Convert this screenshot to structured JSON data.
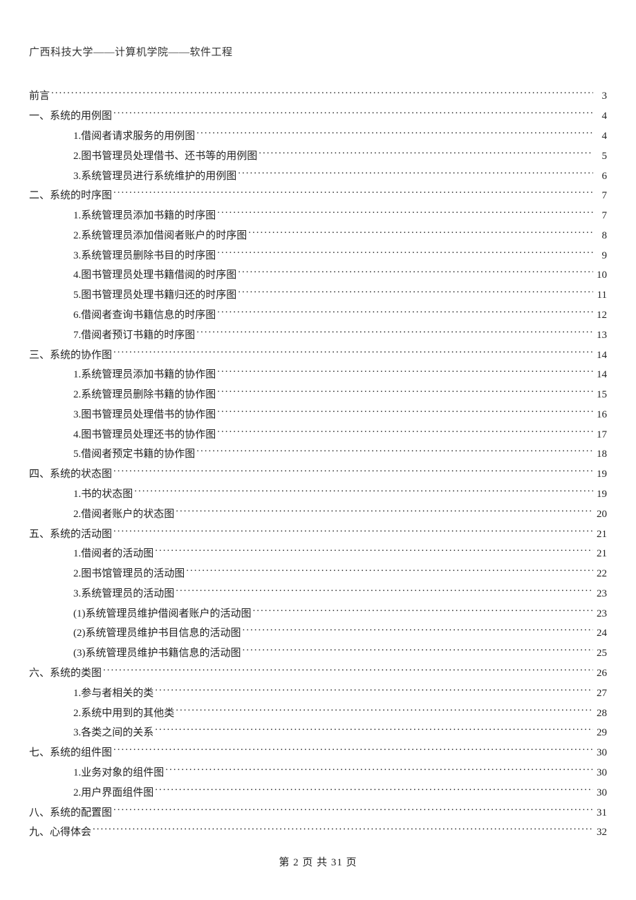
{
  "header": "广西科技大学——计算机学院——软件工程",
  "footer": "第 2 页 共 31 页",
  "toc": [
    {
      "level": 0,
      "title": "前言",
      "page": 3
    },
    {
      "level": 0,
      "title": "一、系统的用例图",
      "page": 4
    },
    {
      "level": 1,
      "title": "1.借阅者请求服务的用例图",
      "page": 4
    },
    {
      "level": 1,
      "title": "2.图书管理员处理借书、还书等的用例图",
      "page": 5
    },
    {
      "level": 1,
      "title": "3.系统管理员进行系统维护的用例图",
      "page": 6
    },
    {
      "level": 0,
      "title": "二、系统的时序图",
      "page": 7
    },
    {
      "level": 1,
      "title": "1.系统管理员添加书籍的时序图",
      "page": 7
    },
    {
      "level": 1,
      "title": "2.系统管理员添加借阅者账户的时序图",
      "page": 8
    },
    {
      "level": 1,
      "title": "3.系统管理员删除书目的时序图",
      "page": 9
    },
    {
      "level": 1,
      "title": "4.图书管理员处理书籍借阅的时序图",
      "page": 10
    },
    {
      "level": 1,
      "title": "5.图书管理员处理书籍归还的时序图",
      "page": 11
    },
    {
      "level": 1,
      "title": "6.借阅者查询书籍信息的时序图",
      "page": 12
    },
    {
      "level": 1,
      "title": "7.借阅者预订书籍的时序图",
      "page": 13
    },
    {
      "level": 0,
      "title": "三、系统的协作图",
      "page": 14
    },
    {
      "level": 1,
      "title": "1.系统管理员添加书籍的协作图",
      "page": 14
    },
    {
      "level": 1,
      "title": "2.系统管理员删除书籍的协作图",
      "page": 15
    },
    {
      "level": 1,
      "title": "3.图书管理员处理借书的协作图",
      "page": 16
    },
    {
      "level": 1,
      "title": "4.图书管理员处理还书的协作图",
      "page": 17
    },
    {
      "level": 1,
      "title": "5.借阅者预定书籍的协作图",
      "page": 18
    },
    {
      "level": 0,
      "title": "四、系统的状态图",
      "page": 19
    },
    {
      "level": 1,
      "title": "1.书的状态图",
      "page": 19
    },
    {
      "level": 1,
      "title": "2.借阅者账户的状态图",
      "page": 20
    },
    {
      "level": 0,
      "title": "五、系统的活动图",
      "page": 21
    },
    {
      "level": 1,
      "title": "1.借阅者的活动图",
      "page": 21
    },
    {
      "level": 1,
      "title": "2.图书馆管理员的活动图",
      "page": 22
    },
    {
      "level": 1,
      "title": "3.系统管理员的活动图",
      "page": 23
    },
    {
      "level": 1,
      "title": "(1)系统管理员维护借阅者账户的活动图",
      "page": 23
    },
    {
      "level": 1,
      "title": "(2)系统管理员维护书目信息的活动图",
      "page": 24
    },
    {
      "level": 1,
      "title": "(3)系统管理员维护书籍信息的活动图",
      "page": 25
    },
    {
      "level": 0,
      "title": "六、系统的类图",
      "page": 26
    },
    {
      "level": 1,
      "title": "1.参与者相关的类",
      "page": 27
    },
    {
      "level": 1,
      "title": "2.系统中用到的其他类",
      "page": 28
    },
    {
      "level": 1,
      "title": "3.各类之间的关系",
      "page": 29
    },
    {
      "level": 0,
      "title": "七、系统的组件图",
      "page": 30
    },
    {
      "level": 1,
      "title": "1.业务对象的组件图",
      "page": 30
    },
    {
      "level": 1,
      "title": "2.用户界面组件图",
      "page": 30
    },
    {
      "level": 0,
      "title": "八、系统的配置图",
      "page": 31
    },
    {
      "level": 0,
      "title": "九、心得体会",
      "page": 32
    }
  ]
}
